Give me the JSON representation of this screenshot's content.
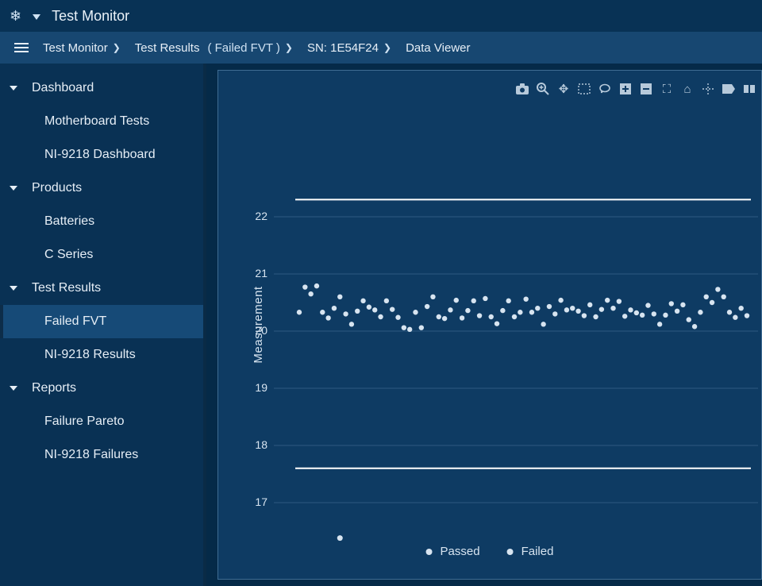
{
  "app": {
    "title": "Test Monitor"
  },
  "breadcrumbs": {
    "b0": "Test Monitor",
    "b1": "Test Results",
    "b1_filter": "( Failed FVT )",
    "b2": "SN: 1E54F24",
    "b3": "Data Viewer"
  },
  "sidebar": {
    "g0": {
      "label": "Dashboard",
      "items": [
        "Motherboard Tests",
        "NI-9218 Dashboard"
      ]
    },
    "g1": {
      "label": "Products",
      "items": [
        "Batteries",
        "C Series"
      ]
    },
    "g2": {
      "label": "Test Results",
      "items": [
        "Failed FVT",
        "NI-9218 Results"
      ],
      "active_index": 0
    },
    "g3": {
      "label": "Reports",
      "items": [
        "Failure Pareto",
        "NI-9218 Failures"
      ]
    }
  },
  "toolbar_icons": [
    "camera-icon",
    "zoom-in-icon",
    "pan-icon",
    "box-select-icon",
    "lasso-icon",
    "zoom-plus-icon",
    "zoom-minus-icon",
    "autoscale-icon",
    "home-icon",
    "spike-icon",
    "label-icon",
    "compare-icon"
  ],
  "legend": {
    "passed": "Passed",
    "failed": "Failed"
  },
  "chart_data": {
    "type": "scatter",
    "ylabel": "Measurement",
    "ylim": [
      16,
      23
    ],
    "yticks": [
      17,
      18,
      19,
      20,
      21,
      22
    ],
    "upper_limit": 22.3,
    "lower_limit": 17.6,
    "series": [
      {
        "name": "Passed",
        "values": [
          20.33,
          20.77,
          20.65,
          20.79,
          20.33,
          20.23,
          20.4,
          20.6,
          20.3,
          20.12,
          20.35,
          20.53,
          20.42,
          20.37,
          20.25,
          20.53,
          20.38,
          20.24,
          20.06,
          20.03,
          20.33,
          20.06,
          20.43,
          20.6,
          20.25,
          20.22,
          20.37,
          20.54,
          20.23,
          20.36,
          20.53,
          20.27,
          20.57,
          20.25,
          20.13,
          20.36,
          20.53,
          20.25,
          20.33,
          20.56,
          20.33,
          20.4,
          20.12,
          20.43,
          20.3,
          20.54,
          20.37,
          20.4,
          20.35,
          20.27,
          20.46,
          20.25,
          20.38,
          20.54,
          20.4,
          20.52,
          20.26,
          20.37,
          20.32,
          20.28,
          20.45,
          20.3,
          20.12,
          20.28,
          20.48,
          20.35,
          20.46,
          20.2,
          20.08,
          20.33,
          20.6,
          20.5,
          20.73,
          20.6,
          20.33,
          20.24,
          20.4,
          20.27
        ]
      },
      {
        "name": "Failed",
        "values": [
          {
            "index": 7,
            "value": 16.38
          }
        ]
      }
    ]
  }
}
